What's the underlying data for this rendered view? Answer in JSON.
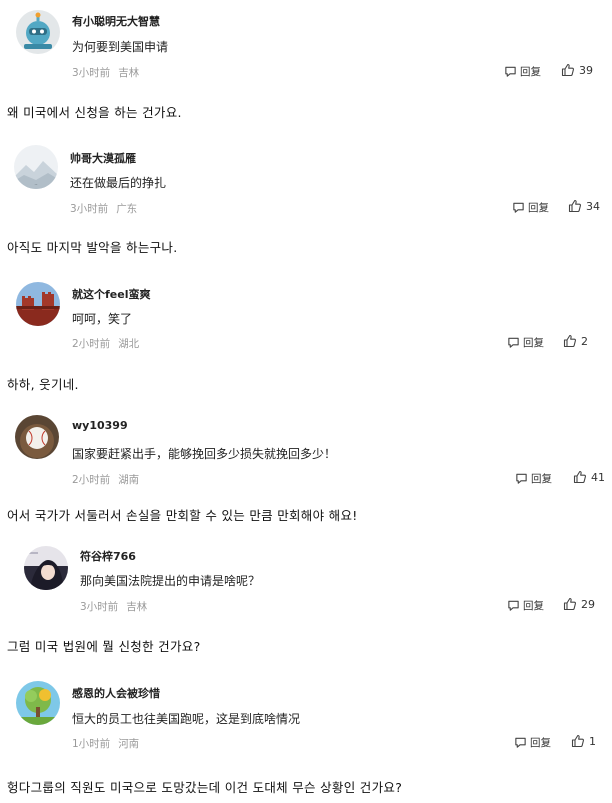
{
  "labels": {
    "reply": "回复"
  },
  "comments": [
    {
      "user": "有小聪明无大智慧",
      "text": "为何要到美国申请",
      "time": "3小时前",
      "location": "吉林",
      "likes": "39",
      "translation": "왜 미국에서 신청을 하는 건가요.",
      "avatar": "robot-avatar"
    },
    {
      "user": "帅哥大漠孤雁",
      "text": "还在做最后的挣扎",
      "time": "3小时前",
      "location": "广东",
      "likes": "34",
      "translation": "아직도 마지막 발악을 하는구나.",
      "avatar": "landscape-avatar"
    },
    {
      "user": "就这个feel蛮爽",
      "text": "呵呵，笑了",
      "time": "2小时前",
      "location": "湖北",
      "likes": "2",
      "translation": "하하, 웃기네.",
      "avatar": "great-wall-avatar"
    },
    {
      "user": "wy10399",
      "text": "国家要赶紧出手，能够挽回多少损失就挽回多少！",
      "time": "2小时前",
      "location": "湖南",
      "likes": "41",
      "translation": "어서 국가가 서둘러서 손실을 만회할 수 있는 만큼 만회해야 해요!",
      "avatar": "baseball-avatar"
    },
    {
      "user": "符谷梓766",
      "text": "那向美国法院提出的申请是啥呢？",
      "time": "3小时前",
      "location": "吉林",
      "likes": "29",
      "translation": "그럼 미국 법원에 뭘 신청한 건가요?",
      "avatar": "anime-avatar"
    },
    {
      "user": "感恩的人会被珍惜",
      "text": "恒大的员工也往美国跑呢，这是到底啥情况",
      "time": "1小时前",
      "location": "河南",
      "likes": "1",
      "translation": "헝다그룹의 직원도 미국으로 도망갔는데 이건 도대체 무슨 상황인 건가요?",
      "avatar": "tree-avatar"
    }
  ]
}
